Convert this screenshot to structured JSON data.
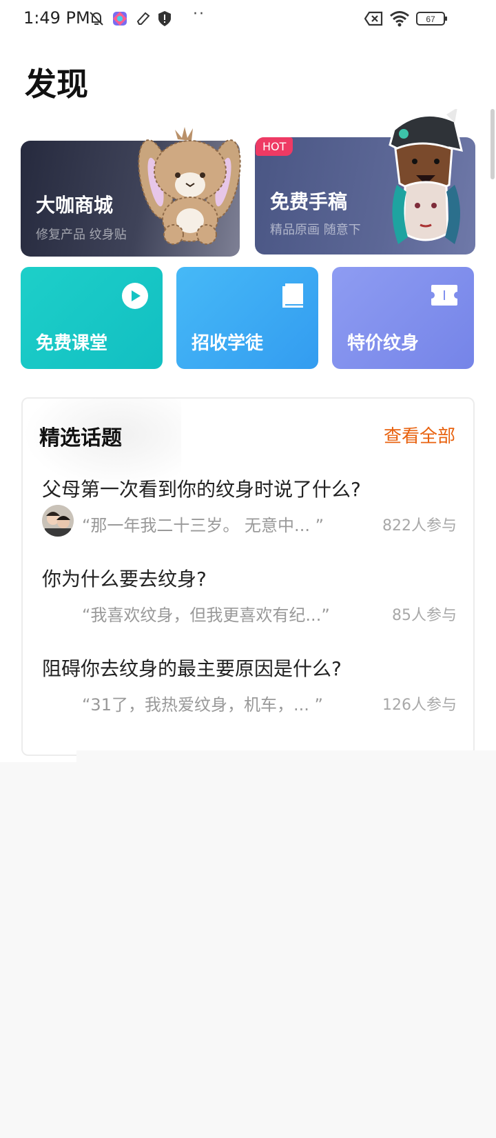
{
  "status_bar": {
    "time": "1:49 PM",
    "dots": "··",
    "battery": "67",
    "icons": [
      "mute-bell-icon",
      "app-icon",
      "edit-icon",
      "shield-icon",
      "sim-off-icon",
      "wifi-icon",
      "battery-icon"
    ]
  },
  "page": {
    "title": "发现"
  },
  "cards": {
    "mall": {
      "title": "大咖商城",
      "subtitle": "修复产品 纹身贴"
    },
    "draft": {
      "badge": "HOT",
      "title": "免费手稿",
      "subtitle": "精品原画 随意下"
    }
  },
  "shortcuts": [
    {
      "label": "免费课堂",
      "icon": "play-icon"
    },
    {
      "label": "招收学徒",
      "icon": "book-icon"
    },
    {
      "label": "特价纹身",
      "icon": "ticket-icon"
    }
  ],
  "topics": {
    "heading": "精选话题",
    "more": "查看全部",
    "items": [
      {
        "question": "父母第一次看到你的纹身时说了什么?",
        "quote": "“那一年我二十三岁。 无意中...  ”",
        "count": "822人参与"
      },
      {
        "question": "你为什么要去纹身?",
        "quote": "“我喜欢纹身，但我更喜欢有纪...”",
        "count": "85人参与"
      },
      {
        "question": "阻碍你去纹身的最主要原因是什么?",
        "quote": "“31了，我热爱纹身，机车，...  ”",
        "count": "126人参与"
      }
    ]
  },
  "colors": {
    "accent_orange": "#e8620f",
    "hot_pink": "#ee3a64",
    "teal": "#12bfc2",
    "blue": "#339cf0",
    "violet": "#7584e8"
  }
}
